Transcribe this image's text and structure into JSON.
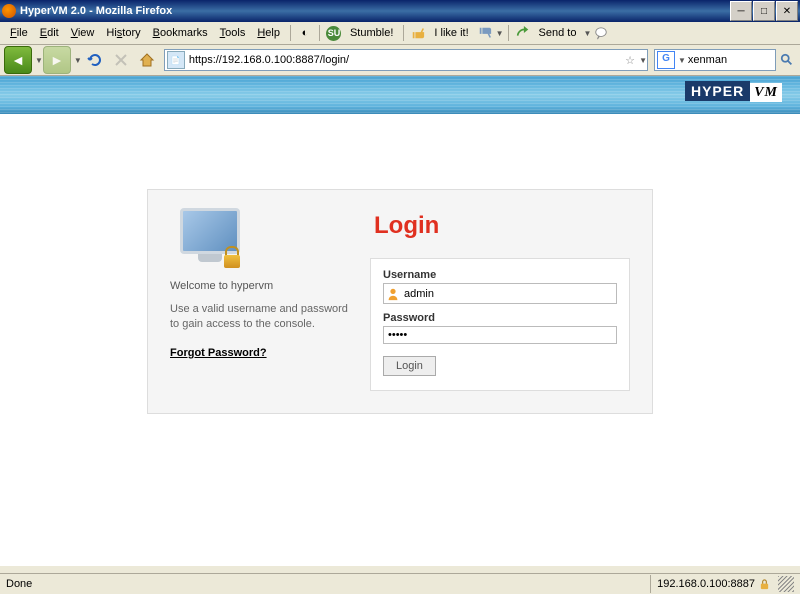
{
  "window": {
    "title": "HyperVM 2.0 - Mozilla Firefox"
  },
  "menu": {
    "file": "File",
    "edit": "Edit",
    "view": "View",
    "history": "History",
    "bookmarks": "Bookmarks",
    "tools": "Tools",
    "help": "Help"
  },
  "stumble": {
    "stumble_label": "Stumble!",
    "like_label": "I like it!",
    "send_label": "Send to"
  },
  "toolbar": {
    "url": "https://192.168.0.100:8887/login/",
    "search_value": "xenman"
  },
  "page": {
    "logo_left": "HYPER",
    "logo_right": "VM",
    "welcome": "Welcome to hypervm",
    "help": "Use a valid username and password to gain access to the console.",
    "forgot": "Forgot Password?",
    "login_heading": "Login",
    "username_label": "Username",
    "username_value": "admin",
    "password_label": "Password",
    "password_value": "•••••",
    "login_button": "Login"
  },
  "status": {
    "left": "Done",
    "right": "192.168.0.100:8887"
  }
}
